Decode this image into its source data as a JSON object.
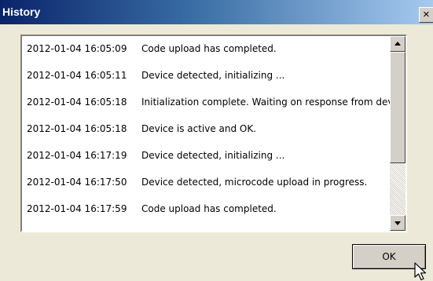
{
  "window": {
    "title": "History",
    "close_glyph": "×"
  },
  "history": {
    "entries": [
      {
        "timestamp": "2012-01-04 16:05:09",
        "message": "Code upload has completed."
      },
      {
        "timestamp": "2012-01-04 16:05:11",
        "message": "Device detected, initializing ..."
      },
      {
        "timestamp": "2012-01-04 16:05:18",
        "message": "Initialization complete. Waiting on response from device"
      },
      {
        "timestamp": "2012-01-04 16:05:18",
        "message": "Device is active and OK."
      },
      {
        "timestamp": "2012-01-04 16:17:19",
        "message": "Device detected, initializing ..."
      },
      {
        "timestamp": "2012-01-04 16:17:50",
        "message": "Device detected, microcode upload in progress."
      },
      {
        "timestamp": "2012-01-04 16:17:59",
        "message": "Code upload has completed."
      }
    ]
  },
  "buttons": {
    "ok_label": "OK"
  },
  "colors": {
    "titlebar_start": "#0a246a",
    "titlebar_end": "#a6caf0",
    "face": "#ece9d8"
  },
  "icons": {
    "close": "close-icon",
    "scroll_up": "scroll-up-arrow-icon",
    "scroll_down": "scroll-down-arrow-icon",
    "cursor": "mouse-pointer-icon"
  }
}
